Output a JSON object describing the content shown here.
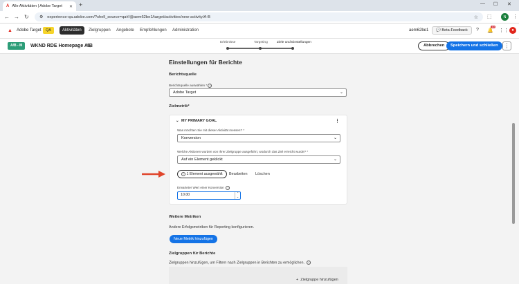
{
  "browser": {
    "tab_title": "Alle Aktivitäten | Adobe Target",
    "url": "experience-qa.adobe.com/?shell_source=qa#/@aem62be1/target/activities/new-activity/A-B",
    "avatar_letter": "N"
  },
  "app": {
    "brand": "Adobe Target",
    "env_badge": "QA",
    "nav": [
      "Aktivitäten",
      "Zielgruppen",
      "Angebote",
      "Empfehlungen",
      "Administration"
    ],
    "user": "aem62be1",
    "beta_feedback": "Beta-Feedback",
    "notif_count": "10"
  },
  "activity": {
    "type_badge": "A/B - M",
    "title": "WKND RDE Homepage A/B",
    "steps": [
      "Erlebnisse",
      "Targeting",
      "Ziele und Einstellungen"
    ],
    "current_step": 2,
    "cancel": "Abbrechen",
    "save_close": "Speichern und schließen"
  },
  "form": {
    "heading": "Einstellungen für Berichte",
    "report_source": {
      "heading": "Berichtsquelle",
      "label": "Berichtsquelle auswählen",
      "value": "Adobe Target"
    },
    "goal_metric": {
      "heading": "Zielmetrik*",
      "card_title": "MY PRIMARY GOAL",
      "measure_label": "Was möchten Sie mit dieser Aktivität messen?",
      "measure_value": "Konversion",
      "action_label": "Welche Aktionen wurden von Ihrer Zielgruppe ausgeführt, wodurch das Ziel erreicht wurde?",
      "action_value": "Auf ein Element geklickt",
      "selected_elements": "1 Element ausgewählt",
      "edit": "Bearbeiten",
      "delete": "Löschen",
      "expected_label": "Erwarteter Wert einer Konversion",
      "expected_value": "10.00"
    },
    "more_metrics": {
      "heading": "Weitere Metriken",
      "desc": "Andere Erfolgsmetriken für Reporting konfigurieren.",
      "add_button": "Neue Metrik hinzufügen"
    },
    "report_audiences": {
      "heading": "Zielgruppen für Berichte",
      "desc": "Zielgruppen hinzufügen, um Filtern nach Zielgruppen in Berichten zu ermöglichen.",
      "add_button": "Zielgruppe hinzufügen"
    }
  },
  "colors": {
    "accent": "#1473e6",
    "annotation_arrow": "#e0452b",
    "qa_badge": "#f6d42a",
    "ab_badge": "#2d9d78"
  }
}
